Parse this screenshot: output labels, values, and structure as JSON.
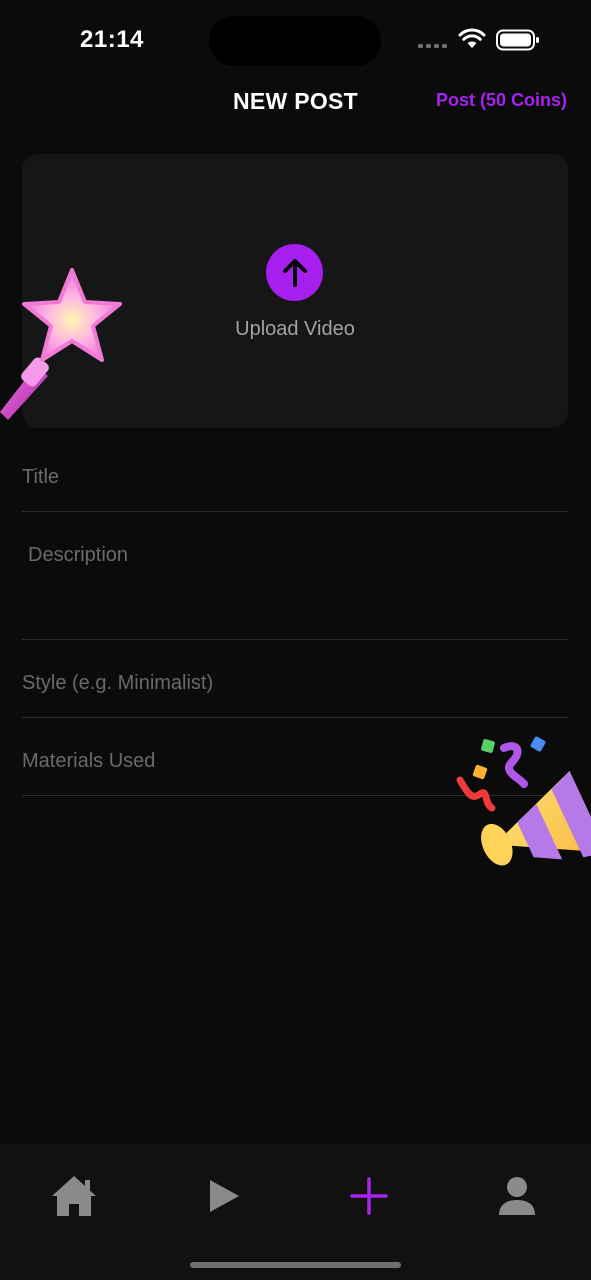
{
  "status_bar": {
    "time": "21:14"
  },
  "header": {
    "title": "NEW POST",
    "post_label": "Post (50 Coins)"
  },
  "upload": {
    "label": "Upload Video",
    "icon": "arrow-up-icon"
  },
  "form": {
    "title_placeholder": "Title",
    "description_placeholder": "Description",
    "style_placeholder": "Style (e.g. Minimalist)",
    "materials_placeholder": "Materials Used"
  },
  "decorations": [
    "star-wand-sticker",
    "party-popper-sticker"
  ],
  "tab_bar": {
    "items": [
      {
        "name": "home",
        "icon": "home-icon",
        "active": false
      },
      {
        "name": "play",
        "icon": "play-icon",
        "active": false
      },
      {
        "name": "add",
        "icon": "plus-icon",
        "active": true
      },
      {
        "name": "profile",
        "icon": "person-icon",
        "active": false
      }
    ]
  },
  "colors": {
    "accent": "#a722f0",
    "background": "#0b0b0b",
    "card": "#161616",
    "tab_inactive": "#8a8a8a"
  }
}
